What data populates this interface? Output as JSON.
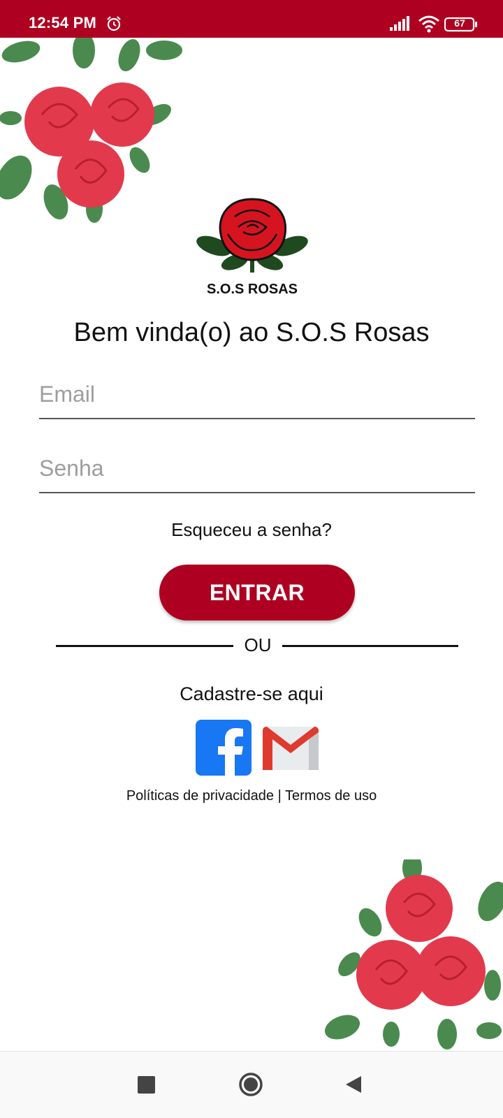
{
  "status_bar": {
    "time": "12:54 PM",
    "battery": "67",
    "icons": [
      "alarm-icon",
      "signal-icon",
      "wifi-icon",
      "battery-icon"
    ]
  },
  "app": {
    "logo_text": "S.O.S ROSAS",
    "welcome": "Bem vinda(o) ao S.O.S Rosas",
    "accent_color": "#ae0020"
  },
  "form": {
    "email_placeholder": "Email",
    "password_placeholder": "Senha",
    "forgot_password": "Esqueceu a senha?",
    "enter_button": "ENTRAR"
  },
  "divider": {
    "text": "OU"
  },
  "signup": {
    "label": "Cadastre-se aqui",
    "providers": [
      "facebook-icon",
      "gmail-icon"
    ]
  },
  "legal": {
    "privacy": "Políticas de privacidade",
    "separator": "|",
    "terms": "Termos de uso"
  },
  "nav": {
    "icons": [
      "recents-icon",
      "home-icon",
      "back-icon"
    ]
  }
}
